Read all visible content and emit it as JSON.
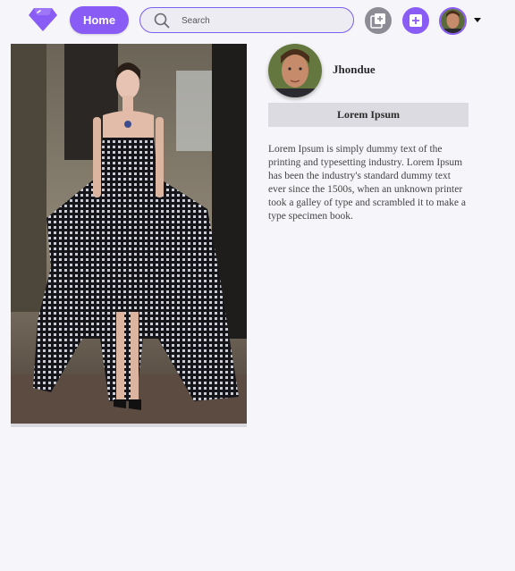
{
  "nav": {
    "home_label": "Home",
    "search_placeholder": "Search",
    "icons": {
      "logo": "diamond-logo",
      "search": "search-icon",
      "gallery": "add-to-collection-icon",
      "add": "add-icon",
      "dropdown": "caret-down-icon"
    },
    "accent_color": "#8a5cf6"
  },
  "profile": {
    "username": "Jhondue",
    "section_label": "Lorem Ipsum",
    "description": "Lorem Ipsum is simply dummy text of the printing and typesetting industry. Lorem Ipsum has been the industry's standard dummy text ever since the 1500s, when an unknown printer took a galley of type and scrambled it to make a type specimen book."
  }
}
